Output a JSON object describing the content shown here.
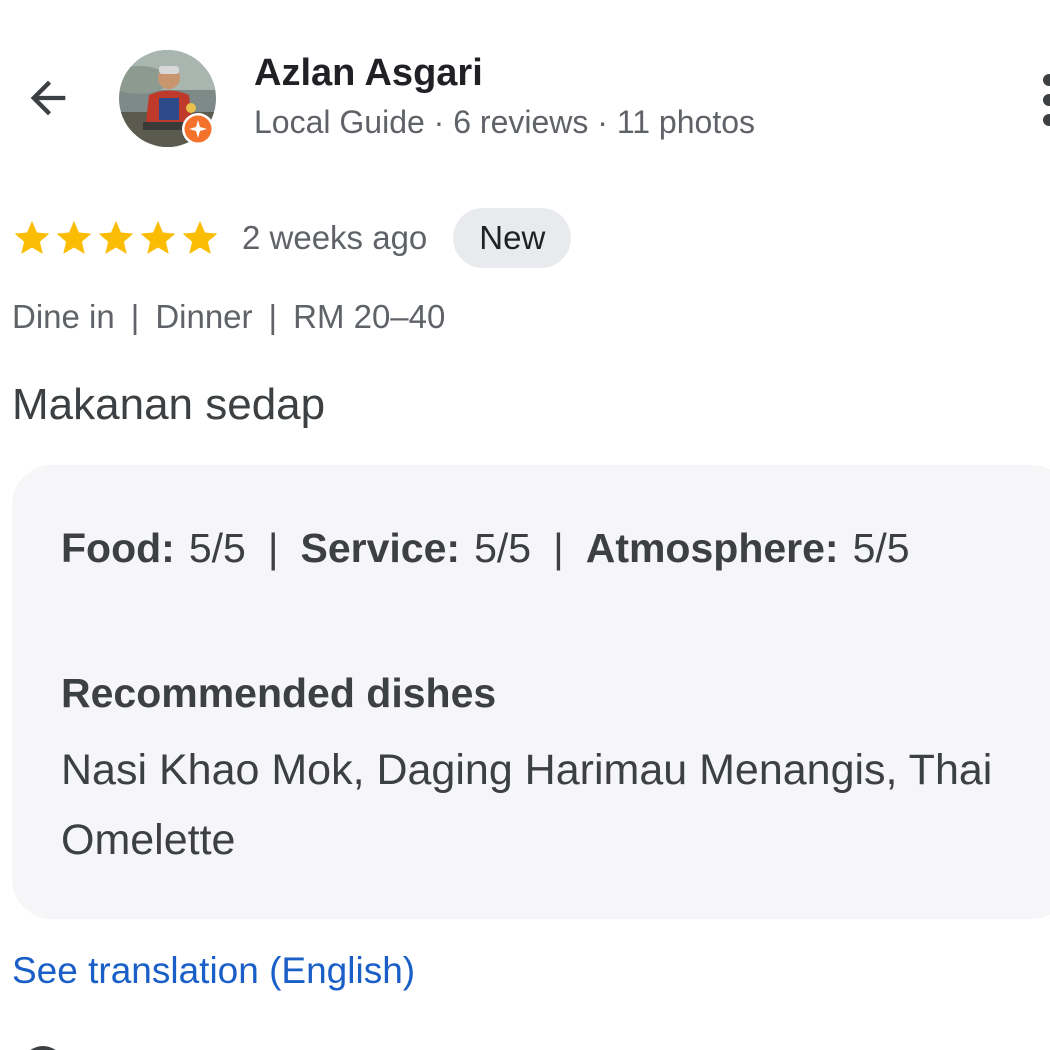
{
  "author": {
    "name": "Azlan Asgari",
    "meta": "Local Guide · 6 reviews · 11 photos"
  },
  "icons": {
    "back": "arrow-back-icon",
    "more": "more-vert-icon",
    "badge": "local-guide-badge-icon",
    "star": "star-icon"
  },
  "review": {
    "rating": 5,
    "max_rating": 5,
    "time_ago": "2 weeks ago",
    "badge": "New",
    "visit": [
      "Dine in",
      "Dinner",
      "RM 20–40"
    ],
    "visit_separator": "|",
    "text": "Makanan sedap"
  },
  "details": {
    "ratings": [
      {
        "label": "Food:",
        "value": "5/5"
      },
      {
        "label": "Service:",
        "value": "5/5"
      },
      {
        "label": "Atmosphere:",
        "value": "5/5"
      }
    ],
    "separator": "|",
    "recommended_title": "Recommended dishes",
    "recommended_dishes": "Nasi Khao Mok, Daging Harimau Menangis, Thai Omelette"
  },
  "translate_link": "See translation (English)",
  "colors": {
    "star": "#fbbc04",
    "link": "#1a5fc7",
    "badge_bg": "#e8eaed",
    "card_bg": "#f6f6f8",
    "guide_badge": "#f4722b"
  }
}
